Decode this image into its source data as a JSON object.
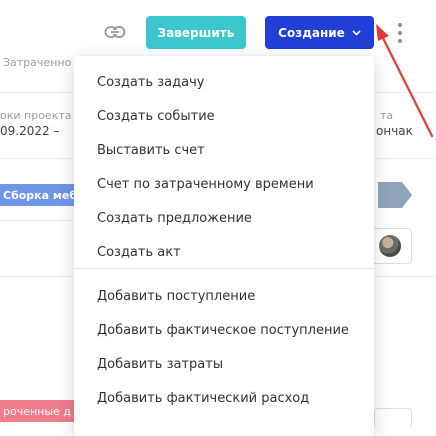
{
  "toolbar": {
    "link_icon": "link-icon",
    "finish_label": "Завершить",
    "create_label": "Создание",
    "create_chevron": "⌄",
    "more_icon": "kebab-vertical-icon"
  },
  "background": {
    "col_header": "Затраченно",
    "proj_dates_label": "оки проекта",
    "start_date": "09.2022 –",
    "right_label_1": "та",
    "right_label_2": "ончак",
    "task_tag": "Сборка меб",
    "overdue_tag": "роченные д"
  },
  "menu": {
    "items": [
      "Создать задачу",
      "Создать событие",
      "Выставить счет",
      "Счет по затраченному времени",
      "Создать предложение",
      "Создать акт",
      "Добавить поступление",
      "Добавить фактическое поступление",
      "Добавить затраты",
      "Добавить фактический расход"
    ]
  },
  "colors": {
    "finish_button": "#3ec6cf",
    "create_button": "#1f3fd6",
    "task_tag": "#6f95e8",
    "overdue_tag": "#f07b8a",
    "gantt_bar": "#8ea3b8",
    "annotation_arrow": "#e23a3a"
  }
}
